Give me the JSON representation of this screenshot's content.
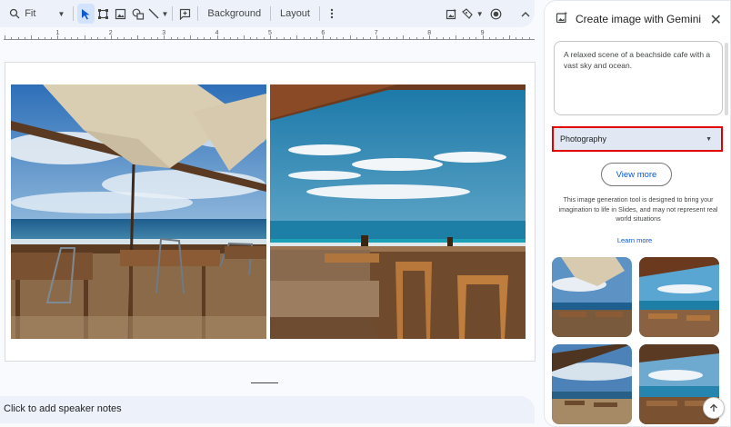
{
  "toolbar": {
    "zoom_label": "Fit",
    "background_label": "Background",
    "layout_label": "Layout"
  },
  "ruler": {
    "numbers": [
      "1",
      "2",
      "3",
      "4",
      "5",
      "6",
      "7",
      "8",
      "9"
    ]
  },
  "notes": {
    "placeholder": "Click to add speaker notes"
  },
  "panel": {
    "title": "Create image with Gemini",
    "prompt": "A relaxed scene of a beachside cafe with a vast sky and ocean.",
    "style_value": "Photography",
    "view_more_label": "View more",
    "disclaimer": "This image generation tool is designed to bring your imagination to life in Slides, and may not represent real world situations",
    "learn_more_label": "Learn more"
  },
  "icons": {
    "cursor": "cursor-icon",
    "select_box": "select-box-icon",
    "image": "image-icon",
    "shape": "shape-icon",
    "line": "line-icon",
    "comment": "add-comment-icon",
    "more": "more-vert-icon",
    "add_image": "add-image-icon",
    "pen": "pen-icon",
    "record": "record-icon",
    "collapse": "chevron-up-icon",
    "gemini": "gemini-image-icon",
    "close": "close-icon",
    "scroll_top": "arrow-up-icon"
  },
  "colors": {
    "accent": "#0b57d0",
    "highlight_border": "#e00000",
    "toolbar_bg": "#edf2fa"
  }
}
